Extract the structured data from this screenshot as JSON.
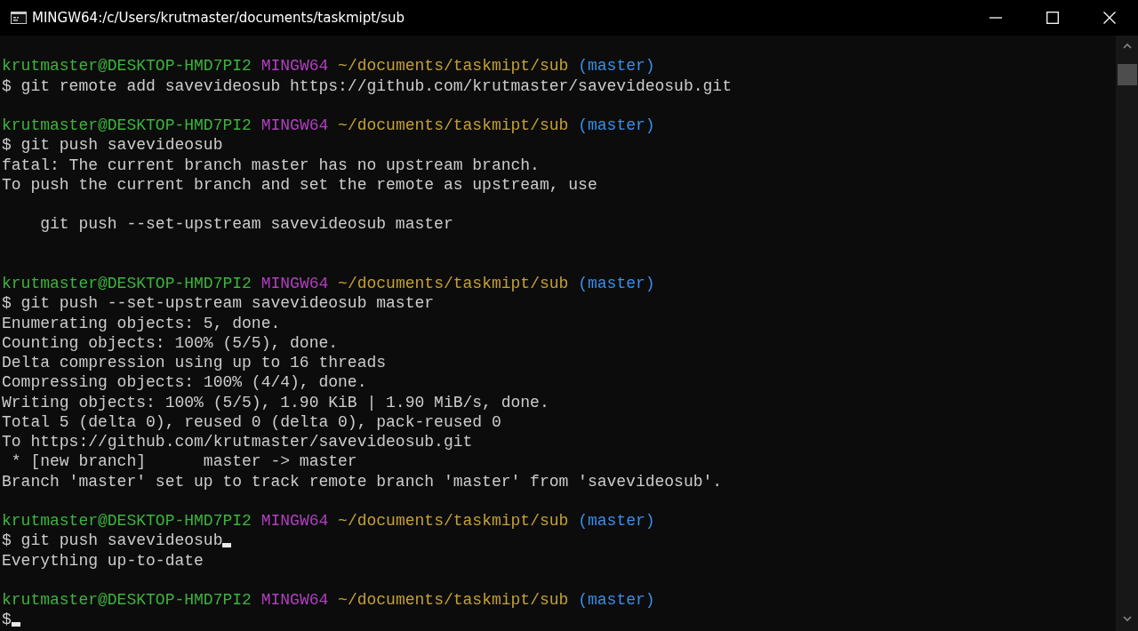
{
  "window": {
    "title": "MINGW64:/c/Users/krutmaster/documents/taskmipt/sub"
  },
  "terminal": {
    "lines": [
      {
        "kind": "blank"
      },
      {
        "kind": "prompt",
        "user_host": "krutmaster@DESKTOP-HMD7PI2",
        "shell": "MINGW64",
        "path": "~/documents/taskmipt/sub",
        "branch": "(master)"
      },
      {
        "kind": "command",
        "text": "$ git remote add savevideosub https://github.com/krutmaster/savevideosub.git",
        "cursor": false
      },
      {
        "kind": "blank"
      },
      {
        "kind": "prompt",
        "user_host": "krutmaster@DESKTOP-HMD7PI2",
        "shell": "MINGW64",
        "path": "~/documents/taskmipt/sub",
        "branch": "(master)"
      },
      {
        "kind": "command",
        "text": "$ git push savevideosub",
        "cursor": false
      },
      {
        "kind": "output",
        "text": "fatal: The current branch master has no upstream branch."
      },
      {
        "kind": "output",
        "text": "To push the current branch and set the remote as upstream, use"
      },
      {
        "kind": "blank"
      },
      {
        "kind": "output",
        "text": "    git push --set-upstream savevideosub master"
      },
      {
        "kind": "blank"
      },
      {
        "kind": "blank"
      },
      {
        "kind": "prompt",
        "user_host": "krutmaster@DESKTOP-HMD7PI2",
        "shell": "MINGW64",
        "path": "~/documents/taskmipt/sub",
        "branch": "(master)"
      },
      {
        "kind": "command",
        "text": "$ git push --set-upstream savevideosub master",
        "cursor": false
      },
      {
        "kind": "output",
        "text": "Enumerating objects: 5, done."
      },
      {
        "kind": "output",
        "text": "Counting objects: 100% (5/5), done."
      },
      {
        "kind": "output",
        "text": "Delta compression using up to 16 threads"
      },
      {
        "kind": "output",
        "text": "Compressing objects: 100% (4/4), done."
      },
      {
        "kind": "output",
        "text": "Writing objects: 100% (5/5), 1.90 KiB | 1.90 MiB/s, done."
      },
      {
        "kind": "output",
        "text": "Total 5 (delta 0), reused 0 (delta 0), pack-reused 0"
      },
      {
        "kind": "output",
        "text": "To https://github.com/krutmaster/savevideosub.git"
      },
      {
        "kind": "output",
        "text": " * [new branch]      master -> master"
      },
      {
        "kind": "output",
        "text": "Branch 'master' set up to track remote branch 'master' from 'savevideosub'."
      },
      {
        "kind": "blank"
      },
      {
        "kind": "prompt",
        "user_host": "krutmaster@DESKTOP-HMD7PI2",
        "shell": "MINGW64",
        "path": "~/documents/taskmipt/sub",
        "branch": "(master)"
      },
      {
        "kind": "command",
        "text": "$ git push savevideosub",
        "cursor": true
      },
      {
        "kind": "output",
        "text": "Everything up-to-date"
      },
      {
        "kind": "blank"
      },
      {
        "kind": "prompt",
        "user_host": "krutmaster@DESKTOP-HMD7PI2",
        "shell": "MINGW64",
        "path": "~/documents/taskmipt/sub",
        "branch": "(master)"
      },
      {
        "kind": "command",
        "text": "$",
        "cursor": true
      }
    ]
  }
}
